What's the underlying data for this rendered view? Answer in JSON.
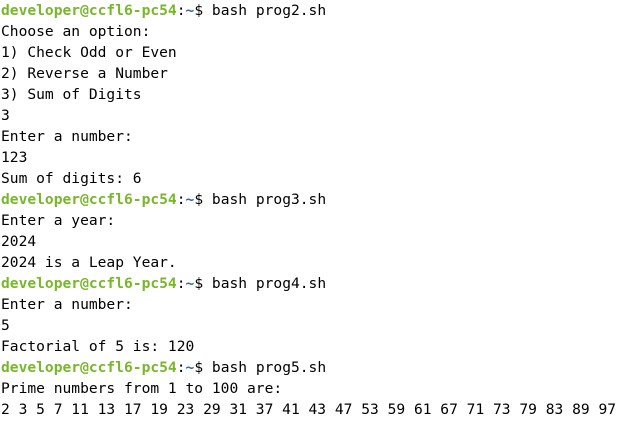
{
  "terminal": {
    "prompt": {
      "user_host": "developer@ccfl6-pc54",
      "colon": ":",
      "path": "~",
      "symbol": "$ "
    },
    "lines": [
      {
        "kind": "prompt",
        "command": "bash prog2.sh"
      },
      {
        "kind": "output",
        "text": "Choose an option:"
      },
      {
        "kind": "output",
        "text": "1) Check Odd or Even"
      },
      {
        "kind": "output",
        "text": "2) Reverse a Number"
      },
      {
        "kind": "output",
        "text": "3) Sum of Digits"
      },
      {
        "kind": "output",
        "text": "3"
      },
      {
        "kind": "output",
        "text": "Enter a number:"
      },
      {
        "kind": "output",
        "text": "123"
      },
      {
        "kind": "output",
        "text": "Sum of digits: 6"
      },
      {
        "kind": "prompt",
        "command": "bash prog3.sh"
      },
      {
        "kind": "output",
        "text": "Enter a year:"
      },
      {
        "kind": "output",
        "text": "2024"
      },
      {
        "kind": "output",
        "text": "2024 is a Leap Year."
      },
      {
        "kind": "prompt",
        "command": "bash prog4.sh"
      },
      {
        "kind": "output",
        "text": "Enter a number:"
      },
      {
        "kind": "output",
        "text": "5"
      },
      {
        "kind": "output",
        "text": "Factorial of 5 is: 120"
      },
      {
        "kind": "prompt",
        "command": "bash prog5.sh"
      },
      {
        "kind": "output",
        "text": "Prime numbers from 1 to 100 are:"
      },
      {
        "kind": "output",
        "text": "2 3 5 7 11 13 17 19 23 29 31 37 41 43 47 53 59 61 67 71 73 79 83 89 97"
      }
    ]
  },
  "colors": {
    "background": "#ffffff",
    "text": "#000000",
    "prompt_user": "#78b72a",
    "prompt_path": "#3465a4"
  }
}
